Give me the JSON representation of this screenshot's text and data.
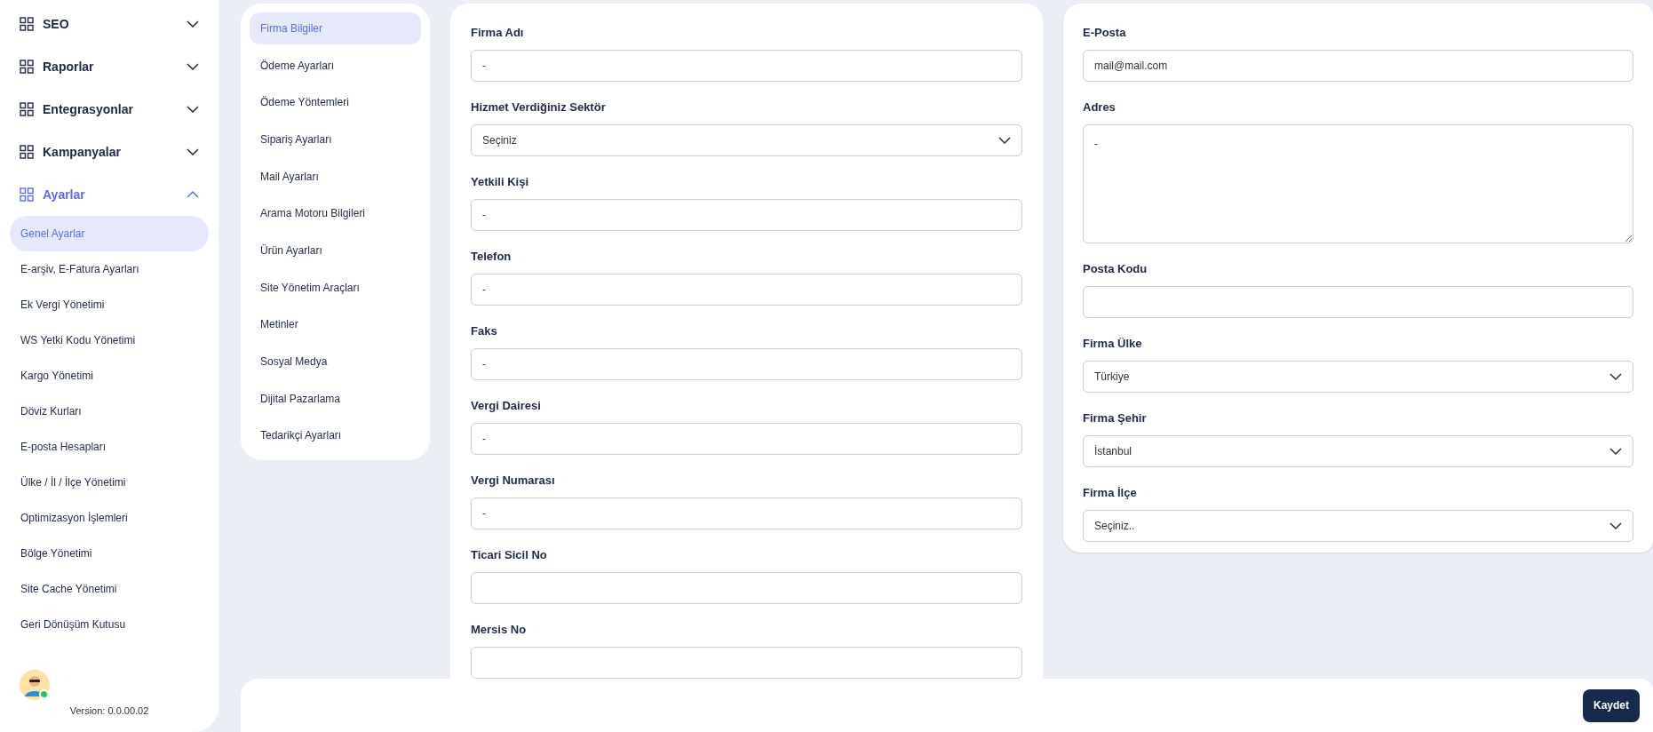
{
  "sidebar": {
    "groups": [
      {
        "label": "SEO",
        "expanded": false
      },
      {
        "label": "Raporlar",
        "expanded": false
      },
      {
        "label": "Entegrasyonlar",
        "expanded": false
      },
      {
        "label": "Kampanyalar",
        "expanded": false
      },
      {
        "label": "Ayarlar",
        "expanded": true,
        "children": [
          {
            "label": "Genel Ayarlar",
            "selected": true
          },
          {
            "label": "E-arşiv, E-Fatura Ayarları",
            "selected": false
          },
          {
            "label": "Ek Vergi Yönetimi",
            "selected": false
          },
          {
            "label": "WS Yetki Kodu Yönetimi",
            "selected": false
          },
          {
            "label": "Kargo Yönetimi",
            "selected": false
          },
          {
            "label": "Döviz Kurları",
            "selected": false
          },
          {
            "label": "E-posta Hesapları",
            "selected": false
          },
          {
            "label": "Ülke / İl / İlçe Yönetimi",
            "selected": false
          },
          {
            "label": "Optimizasyon İşlemleri",
            "selected": false
          },
          {
            "label": "Bölge Yönetimi",
            "selected": false
          },
          {
            "label": "Site Cache Yönetimi",
            "selected": false
          },
          {
            "label": "Geri Dönüşüm Kutusu",
            "selected": false
          }
        ]
      }
    ],
    "user": {
      "online": true
    },
    "version": "Version: 0.0.00.02"
  },
  "settings_menu": [
    {
      "label": "Firma Bilgiler",
      "selected": true
    },
    {
      "label": "Ödeme Ayarları",
      "selected": false
    },
    {
      "label": "Ödeme Yöntemleri",
      "selected": false
    },
    {
      "label": "Sipariş Ayarları",
      "selected": false
    },
    {
      "label": "Mail Ayarları",
      "selected": false
    },
    {
      "label": "Arama Motoru Bilgileri",
      "selected": false
    },
    {
      "label": "Ürün Ayarları",
      "selected": false
    },
    {
      "label": "Site Yönetim Araçları",
      "selected": false
    },
    {
      "label": "Metinler",
      "selected": false
    },
    {
      "label": "Sosyal Medya",
      "selected": false
    },
    {
      "label": "Dijital Pazarlama",
      "selected": false
    },
    {
      "label": "Tedarikçi Ayarları",
      "selected": false
    }
  ],
  "form_left": [
    {
      "label": "Firma Adı",
      "kind": "text",
      "value": "-"
    },
    {
      "label": "Hizmet Verdiğiniz Sektör",
      "kind": "select",
      "value": "Seçiniz"
    },
    {
      "label": "Yetkili Kişi",
      "kind": "text",
      "value": "-"
    },
    {
      "label": "Telefon",
      "kind": "text",
      "value": "-"
    },
    {
      "label": "Faks",
      "kind": "text",
      "value": "-"
    },
    {
      "label": "Vergi Dairesi",
      "kind": "text",
      "value": "-"
    },
    {
      "label": "Vergi Numarası",
      "kind": "text",
      "value": "-"
    },
    {
      "label": "Ticari Sicil No",
      "kind": "text"
    },
    {
      "label": "Mersis No",
      "kind": "text"
    }
  ],
  "form_right": [
    {
      "label": "E-Posta",
      "kind": "text",
      "value": "mail@mail.com"
    },
    {
      "label": "Adres",
      "kind": "textarea",
      "value": "-"
    },
    {
      "label": "Posta Kodu",
      "kind": "text"
    },
    {
      "label": "Firma Ülke",
      "kind": "select",
      "value": "Türkiye"
    },
    {
      "label": "Firma Şehir",
      "kind": "select",
      "value": "İstanbul"
    },
    {
      "label": "Firma İlçe",
      "kind": "select",
      "value": "Seçiniz.."
    }
  ],
  "footer": {
    "save_button": "Kaydet"
  }
}
